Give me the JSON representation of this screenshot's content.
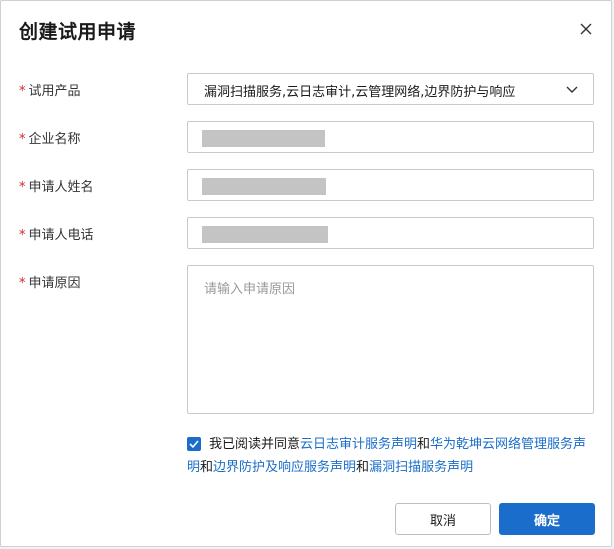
{
  "dialog": {
    "title": "创建试用申请"
  },
  "form": {
    "required_mark": "*",
    "trial_product": {
      "label": "试用产品",
      "value": "漏洞扫描服务,云日志审计,云管理网络,边界防护与响应"
    },
    "company_name": {
      "label": "企业名称"
    },
    "applicant_name": {
      "label": "申请人姓名"
    },
    "applicant_phone": {
      "label": "申请人电话"
    },
    "reason": {
      "label": "申请原因",
      "placeholder": "请输入申请原因"
    }
  },
  "agreement": {
    "checked": true,
    "prefix": "我已阅读并同意",
    "link1": "云日志审计服务声明",
    "and1": "和",
    "link2": "华为乾坤云网络管理服务声明",
    "and2": "和",
    "link3": "边界防护及响应服务声明",
    "and3": "和",
    "link4": "漏洞扫描服务声明"
  },
  "buttons": {
    "cancel": "取消",
    "confirm": "确定"
  },
  "colors": {
    "primary": "#1a6dca",
    "required": "#e02020",
    "border": "#c9c9c9"
  }
}
